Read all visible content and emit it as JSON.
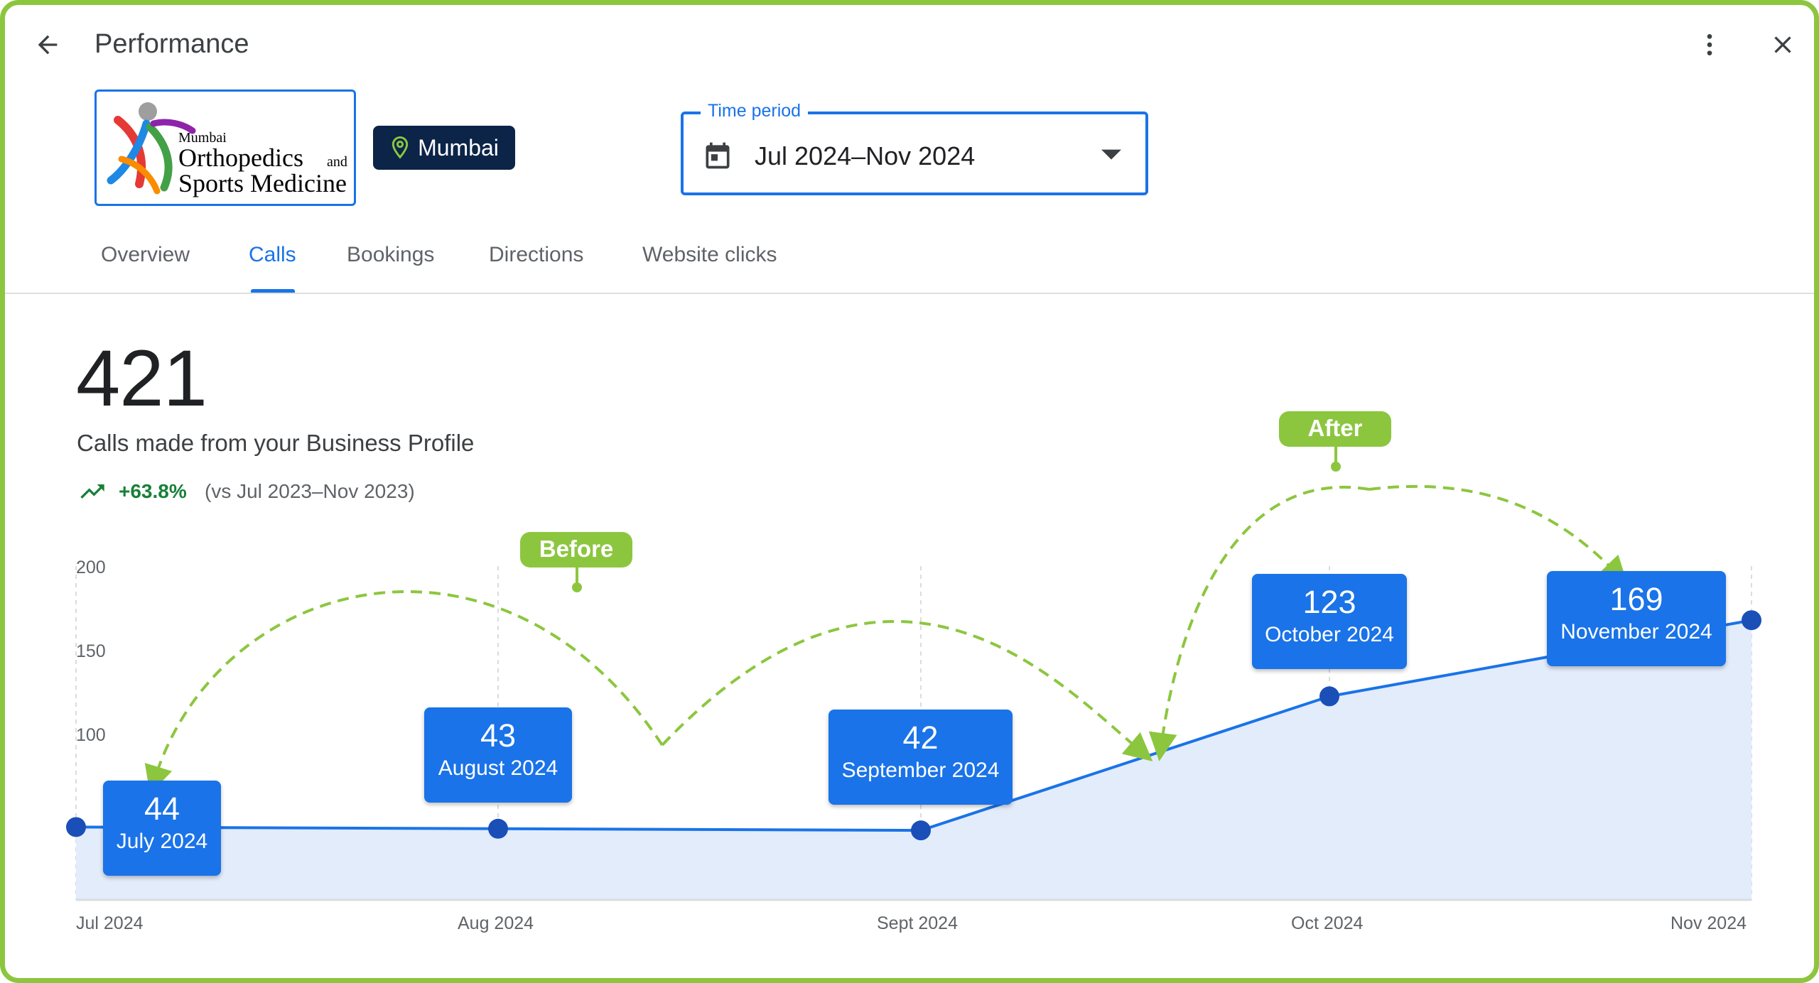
{
  "header": {
    "title": "Performance",
    "back_icon": "arrow-back-icon",
    "more_icon": "more-vert-icon",
    "close_icon": "close-icon"
  },
  "business": {
    "logo_text_city": "Mumbai",
    "logo_text_line1": "Orthopedics",
    "logo_text_and": "and",
    "logo_text_line2": "Sports Medicine",
    "location_label": "Mumbai",
    "location_icon": "location-pin-icon"
  },
  "time_period": {
    "label": "Time period",
    "value": "Jul 2024–Nov 2024",
    "icon": "calendar-icon",
    "dropdown_icon": "dropdown-arrow-icon"
  },
  "tabs": [
    {
      "label": "Overview",
      "active": false
    },
    {
      "label": "Calls",
      "active": true
    },
    {
      "label": "Bookings",
      "active": false
    },
    {
      "label": "Directions",
      "active": false
    },
    {
      "label": "Website clicks",
      "active": false
    }
  ],
  "summary": {
    "total": "421",
    "description": "Calls made from your Business Profile",
    "trend_icon": "trending-up-icon",
    "change": "+63.8%",
    "comparison": "(vs Jul 2023–Nov 2023)"
  },
  "colors": {
    "accent": "#1a73e8",
    "frame": "#8cc63f",
    "positive": "#188038",
    "location_badge": "#0b2447",
    "area_fill": "#e3ecfb"
  },
  "annotations": {
    "before_label": "Before",
    "after_label": "After"
  },
  "chart_data": {
    "type": "area",
    "x_labels": [
      "Jul 2024",
      "Aug 2024",
      "Sept 2024",
      "Oct 2024",
      "Nov 2024"
    ],
    "y_ticks": [
      "200",
      "150",
      "100"
    ],
    "ylim": [
      0,
      200
    ],
    "grid": "vertical dashed",
    "series": [
      {
        "values": [
          44,
          43,
          42,
          123,
          169
        ]
      }
    ],
    "tooltips": [
      {
        "value": "44",
        "label": "July 2024"
      },
      {
        "value": "43",
        "label": "August 2024"
      },
      {
        "value": "42",
        "label": "September 2024"
      },
      {
        "value": "123",
        "label": "October 2024"
      },
      {
        "value": "169",
        "label": "November 2024"
      }
    ]
  }
}
